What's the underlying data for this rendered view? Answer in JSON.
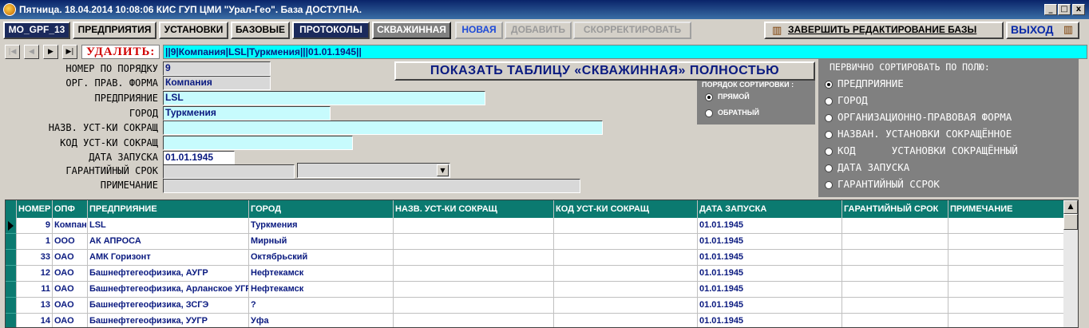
{
  "window": {
    "title": "Пятница. 18.04.2014 10:08:06  КИС ГУП ЦМИ \"Урал-Гео\". База ДОСТУПНА.",
    "controls": [
      "_",
      "□",
      "x"
    ]
  },
  "toolbar": {
    "db_name": "MO_GPF_13",
    "tabs": [
      "ПРЕДПРИЯТИЯ",
      "УСТАНОВКИ",
      "БАЗОВЫЕ",
      "ПРОТОКОЛЫ",
      "СКВАЖИННАЯ"
    ],
    "new_label": "НОВАЯ",
    "add_label": "ДОБАВИТЬ",
    "edit_label": "СКОРРЕКТИРОВАТЬ",
    "finish_label": "ЗАВЕРШИТЬ РЕДАКТИРОВАНИЕ БАЗЫ",
    "exit_label": "ВЫХОД"
  },
  "nav": {
    "first": "|◀",
    "prev": "◀",
    "next": "▶",
    "last": "▶|",
    "delete_label": "УДАЛИТЬ:",
    "record_string": "||9|Компания|LSL|Туркмения|||01.01.1945||"
  },
  "form": {
    "labels": {
      "num": "НОМЕР ПО ПОРЯДКУ",
      "org": "ОРГ. ПРАВ. ФОРМА",
      "company": "ПРЕДПРИЯНИЕ",
      "city": "ГОРОД",
      "unit_name": "НАЗВ. УСТ-КИ СОКРАЩ",
      "unit_code": "КОД   УСТ-КИ СОКРАЩ",
      "date": "ДАТА ЗАПУСКА",
      "warranty": "ГАРАНТИЙНЫЙ СРОК",
      "note": "ПРИМЕЧАНИЕ"
    },
    "values": {
      "num": "9",
      "org": "Компания",
      "company": "LSL",
      "city": "Туркмения",
      "unit_name": "",
      "unit_code": "",
      "date": "01.01.1945",
      "warranty": "",
      "note": ""
    }
  },
  "show_full_label": "ПОКАЗАТЬ ТАБЛИЦУ «СКВАЖИННАЯ» ПОЛНОСТЬЮ",
  "sort_order": {
    "title": "ПОРЯДОК СОРТИРОВКИ :",
    "options": [
      "ПРЯМОЙ",
      "ОБРАТНЫЙ"
    ],
    "selected": "ПРЯМОЙ"
  },
  "primary_sort": {
    "title": "ПЕРВИЧНО СОРТИРОВАТЬ ПО ПОЛЮ:",
    "options": [
      "ПРЕДПРИЯНИЕ",
      "ГОРОД",
      "ОРГАНИЗАЦИОННО-ПРАВОВАЯ ФОРМА",
      "НАЗВАН. УСТАНОВКИ СОКРАЩЁННОЕ",
      "КОД      УСТАНОВКИ СОКРАЩЁННЫЙ",
      "ДАТА ЗАПУСКА",
      "ГАРАНТИЙНЫЙ ССРОК"
    ],
    "selected": "ПРЕДПРИЯНИЕ"
  },
  "table": {
    "columns": [
      "НОМЕР",
      "ОПФ",
      "ПРЕДПРИЯНИЕ",
      "ГОРОД",
      "НАЗВ. УСТ-КИ СОКРАЩ",
      "КОД УСТ-КИ СОКРАЩ",
      "ДАТА ЗАПУСКА",
      "ГАРАНТИЙНЫЙ СРОК",
      "ПРИМЕЧАНИЕ"
    ],
    "rows": [
      [
        "9",
        "Компания",
        "LSL",
        "Туркмения",
        "",
        "",
        "01.01.1945",
        "",
        ""
      ],
      [
        "1",
        "ООО",
        "АК АПРОСА",
        "Мирный",
        "",
        "",
        "01.01.1945",
        "",
        ""
      ],
      [
        "33",
        "ОАО",
        "АМК Горизонт",
        "Октябрьский",
        "",
        "",
        "01.01.1945",
        "",
        ""
      ],
      [
        "12",
        "ОАО",
        "Башнефтегеофизика, АУГР",
        "Нефтекамск",
        "",
        "",
        "01.01.1945",
        "",
        ""
      ],
      [
        "11",
        "ОАО",
        "Башнефтегеофизика, Арланское УГР",
        "Нефтекамск",
        "",
        "",
        "01.01.1945",
        "",
        ""
      ],
      [
        "13",
        "ОАО",
        "Башнефтегеофизика, ЗСГЭ",
        "?",
        "",
        "",
        "01.01.1945",
        "",
        ""
      ],
      [
        "14",
        "ОАО",
        "Башнефтегеофизика, УУГР",
        "Уфа",
        "",
        "",
        "01.01.1945",
        "",
        ""
      ]
    ]
  },
  "colors": {
    "title_bar": "#0a246a",
    "grid_header": "#0b7a70",
    "record_bar": "#00ffff",
    "cyan_field": "#c7fbfd",
    "text_blue": "#0a1a80",
    "delete_red": "#d00000"
  }
}
